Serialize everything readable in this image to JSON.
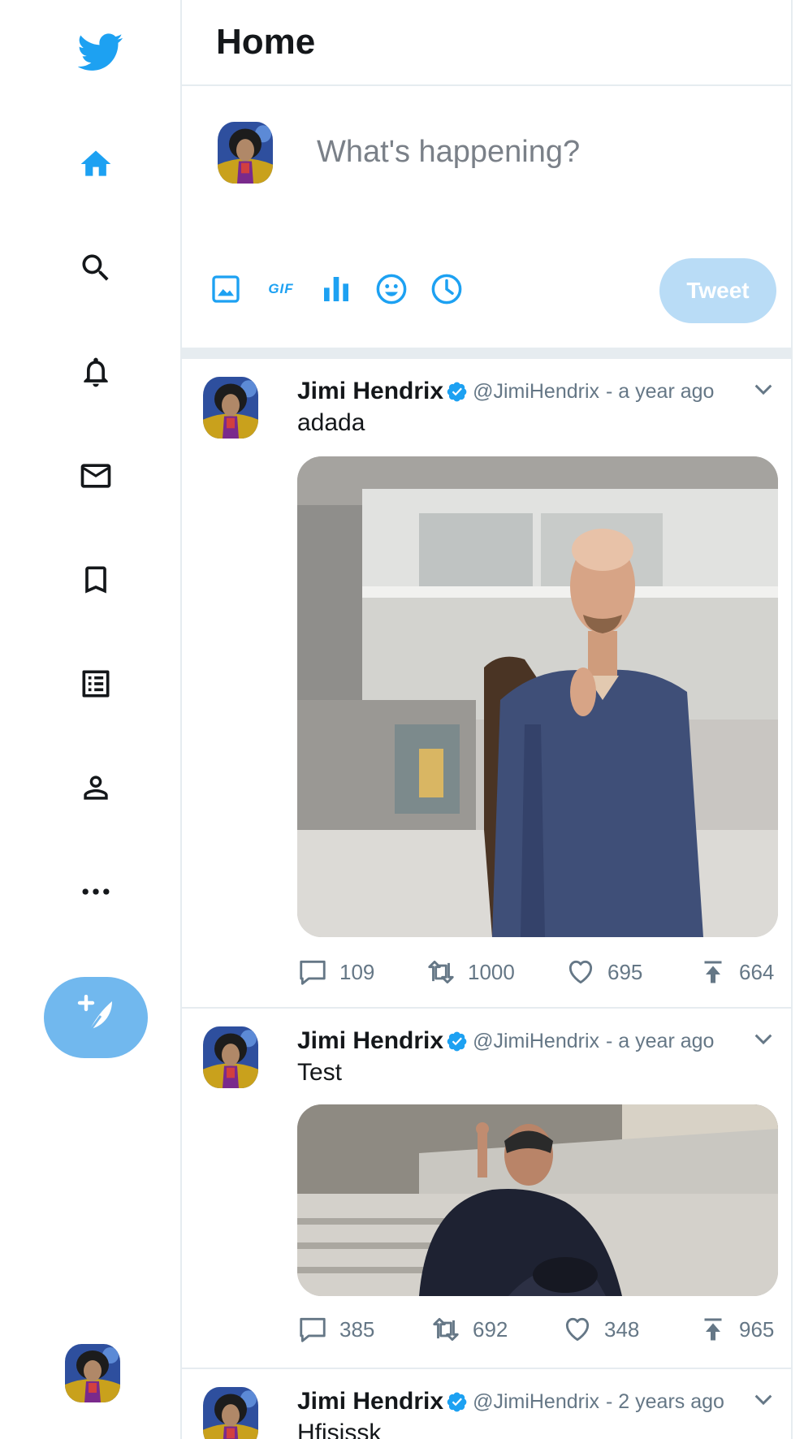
{
  "header": {
    "title": "Home"
  },
  "composer": {
    "placeholder": "What's happening?",
    "tweet_label": "Tweet",
    "gif_label": "GIF"
  },
  "nav": {
    "items": [
      {
        "name": "home",
        "icon": "home-icon",
        "active": true
      },
      {
        "name": "explore",
        "icon": "search-icon"
      },
      {
        "name": "notifications",
        "icon": "bell-icon"
      },
      {
        "name": "messages",
        "icon": "mail-icon"
      },
      {
        "name": "bookmarks",
        "icon": "bookmark-icon"
      },
      {
        "name": "lists",
        "icon": "list-icon"
      },
      {
        "name": "profile",
        "icon": "person-icon"
      },
      {
        "name": "more",
        "icon": "more-icon"
      }
    ]
  },
  "colors": {
    "accent": "#1da1f2",
    "fab": "#71b8ee",
    "tweet_disabled": "#b9dcf6",
    "muted": "#657786",
    "border": "#e6ecf0"
  },
  "tweets": [
    {
      "name": "Jimi Hendrix",
      "handle": "@JimiHendrix",
      "time": "- a year ago",
      "text": "adada",
      "replies": "109",
      "retweets": "1000",
      "likes": "695",
      "shares": "664"
    },
    {
      "name": "Jimi Hendrix",
      "handle": "@JimiHendrix",
      "time": "- a year ago",
      "text": "Test",
      "replies": "385",
      "retweets": "692",
      "likes": "348",
      "shares": "965"
    },
    {
      "name": "Jimi Hendrix",
      "handle": "@JimiHendrix",
      "time": "- 2 years ago",
      "text": "Hfisjssk"
    }
  ]
}
